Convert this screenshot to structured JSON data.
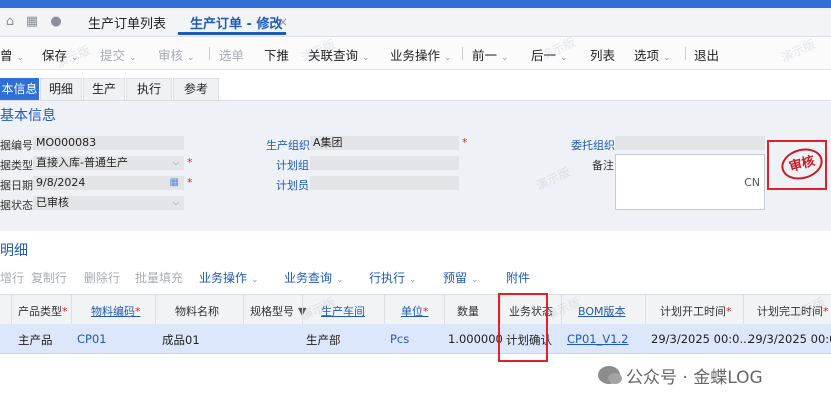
{
  "nav_tabs": {
    "list": "生产订单列表",
    "active": "生产订单 - 修改",
    "close": "×"
  },
  "toolbar": {
    "items": [
      {
        "label": "曾",
        "dis": false
      },
      {
        "label": "保存",
        "dis": false
      },
      {
        "label": "提交",
        "dis": true
      },
      {
        "label": "审核",
        "dis": true
      },
      {
        "label": "选单",
        "dis": true
      },
      {
        "label": "下推",
        "dis": false
      },
      {
        "label": "关联查询",
        "dis": false
      },
      {
        "label": "业务操作",
        "dis": false
      },
      {
        "label": "前一",
        "dis": false
      },
      {
        "label": "后一",
        "dis": false
      },
      {
        "label": "列表",
        "dis": false
      },
      {
        "label": "选项",
        "dis": false
      },
      {
        "label": "退出",
        "dis": false
      }
    ],
    "arrow": "⌄"
  },
  "sub_tabs": [
    "本信息",
    "明细",
    "生产",
    "执行",
    "参考"
  ],
  "basic": {
    "title": "基本信息",
    "bill_no_label": "据编号",
    "bill_no": "MO000083",
    "bill_type_label": "据类型",
    "bill_type": "直接入库-普通生产",
    "date_label": "据日期",
    "date": "9/8/2024",
    "status_label": "据状态",
    "status": "已审核",
    "prod_org_label": "生产组织",
    "prod_org": "A集团",
    "plan_group_label": "计划组",
    "planner_label": "计划员",
    "entrust_org_label": "委托组织",
    "memo_label": "备注",
    "memo_lang": "CN",
    "stamp": "审核",
    "req": "*"
  },
  "detail": {
    "title": "明细",
    "toolbar": [
      {
        "label": "增行",
        "c": "dis"
      },
      {
        "label": "复制行",
        "c": "dis"
      },
      {
        "label": "删除行",
        "c": "dis"
      },
      {
        "label": "批量填充",
        "c": "dis"
      },
      {
        "label": "业务操作",
        "c": "blue",
        "arrow": true
      },
      {
        "label": "业务查询",
        "c": "blue",
        "arrow": true
      },
      {
        "label": "行执行",
        "c": "blue",
        "arrow": true
      },
      {
        "label": "预留",
        "c": "blue",
        "arrow": true
      },
      {
        "label": "附件",
        "c": "blue",
        "arrow": false
      }
    ],
    "columns": [
      "产品类型",
      "物料编码",
      "物料名称",
      "规格型号",
      "生产车间",
      "单位",
      "数量",
      "业务状态",
      "BOM版本",
      "计划开工时间",
      "计划完工时间"
    ],
    "row": [
      "主产品",
      "CP01",
      "成品01",
      "",
      "生产部",
      "Pcs",
      "1.000000",
      "计划确认",
      "CP01_V1.2",
      "29/3/2025 00:0...",
      "29/3/2025 00:0..."
    ]
  },
  "watermark": "演示版",
  "footer": {
    "brand": "公众号 · 金蝶LOG"
  }
}
